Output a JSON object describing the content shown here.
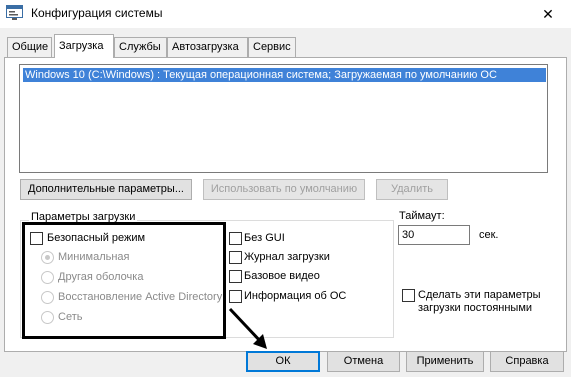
{
  "window": {
    "title": "Конфигурация системы",
    "icon": "msconfig-icon",
    "close_glyph": "✕"
  },
  "tabs": [
    {
      "label": "Общие",
      "active": false
    },
    {
      "label": "Загрузка",
      "active": true
    },
    {
      "label": "Службы",
      "active": false
    },
    {
      "label": "Автозагрузка",
      "active": false
    },
    {
      "label": "Сервис",
      "active": false
    }
  ],
  "os_list": {
    "items": [
      "Windows 10 (C:\\Windows) : Текущая операционная система; Загружаемая по умолчанию ОС"
    ],
    "selected_index": 0
  },
  "list_buttons": {
    "advanced": "Дополнительные параметры...",
    "set_default": "Использовать по умолчанию",
    "delete": "Удалить"
  },
  "boot_options": {
    "legend": "Параметры загрузки",
    "safe_boot": {
      "label": "Безопасный режим",
      "checked": false
    },
    "safe_modes": [
      {
        "label": "Минимальная",
        "selected": true
      },
      {
        "label": "Другая оболочка",
        "selected": false
      },
      {
        "label": "Восстановление Active Directory",
        "selected": false
      },
      {
        "label": "Сеть",
        "selected": false
      }
    ],
    "no_gui": {
      "label": "Без GUI",
      "checked": false
    },
    "boot_log": {
      "label": "Журнал загрузки",
      "checked": false
    },
    "base_video": {
      "label": "Базовое видео",
      "checked": false
    },
    "os_boot_info": {
      "label": "Информация  об ОС",
      "checked": false
    }
  },
  "timeout": {
    "label": "Таймаут:",
    "value": "30",
    "unit": "сек."
  },
  "permanent": {
    "label_line1": "Сделать эти параметры",
    "label_line2": "загрузки постоянными",
    "checked": false
  },
  "dialog_buttons": {
    "ok": "ОК",
    "cancel": "Отмена",
    "apply": "Применить",
    "help": "Справка"
  },
  "colors": {
    "selection": "#3f82d8",
    "default_button_border": "#0078d7",
    "annotation": "#000000"
  }
}
